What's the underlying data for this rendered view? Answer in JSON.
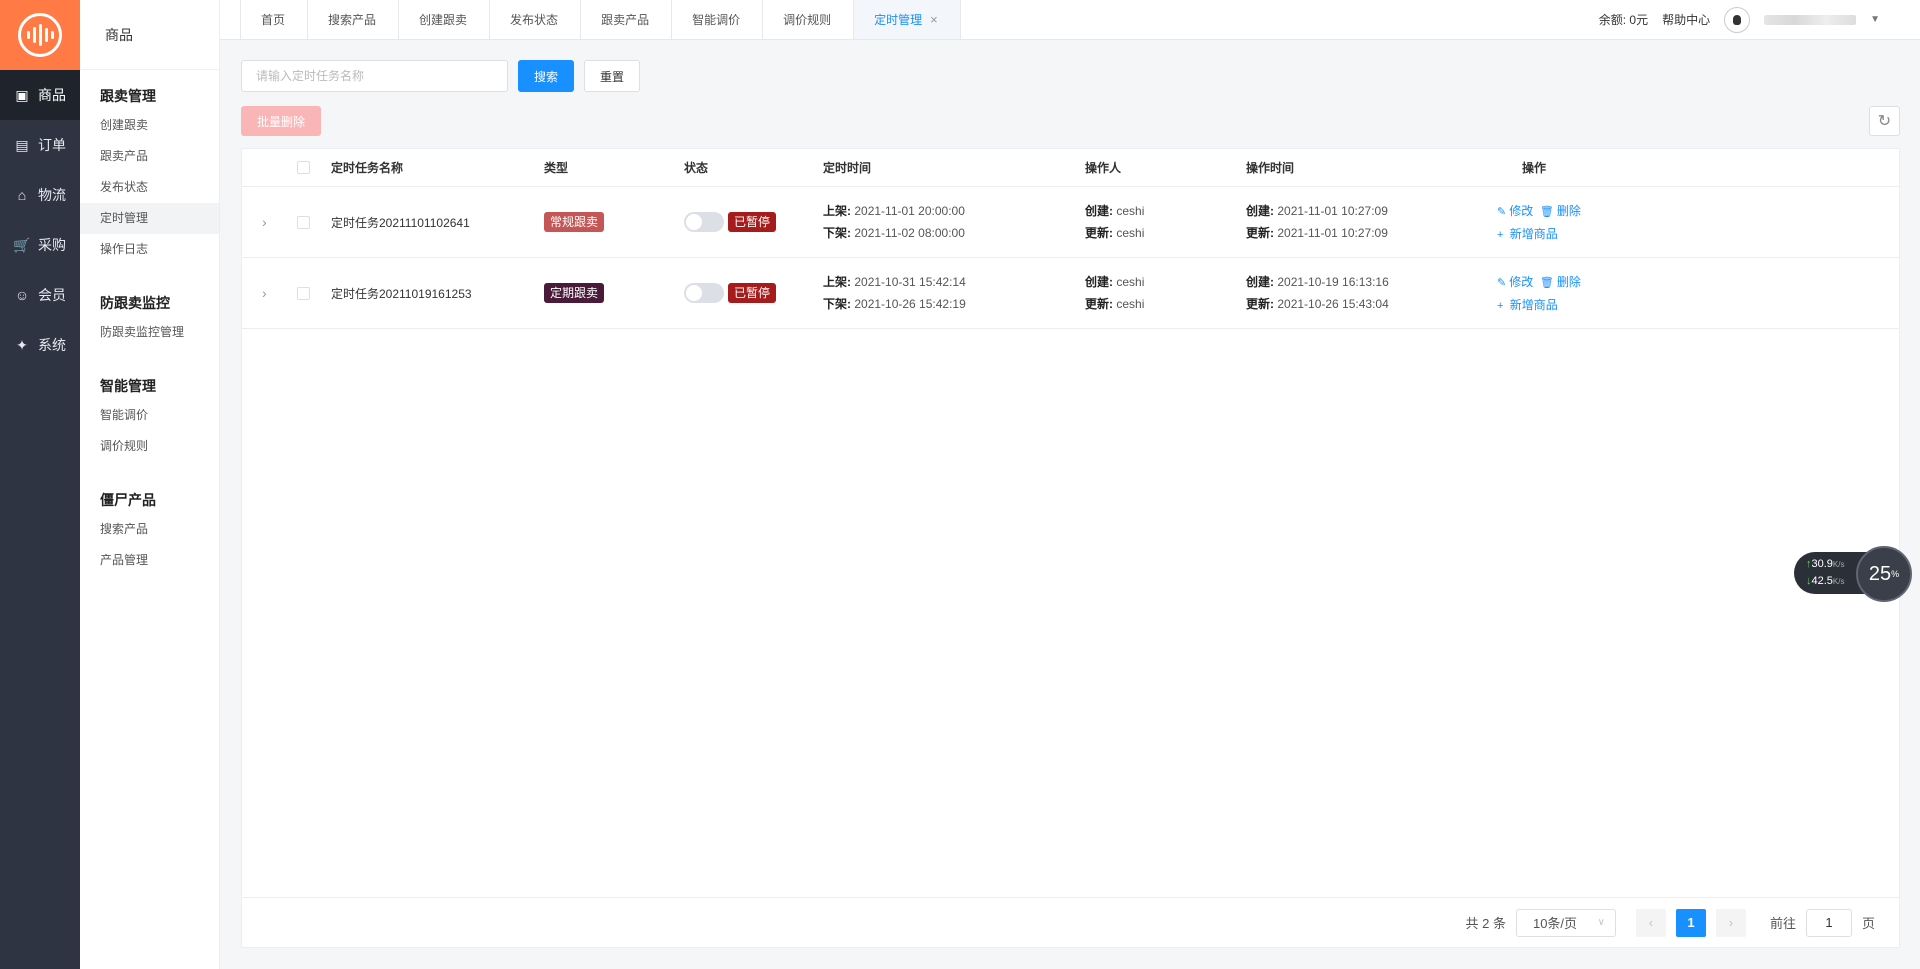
{
  "rail": {
    "items": [
      {
        "label": "商品",
        "icon": "goods-icon",
        "active": true
      },
      {
        "label": "订单",
        "icon": "order-icon",
        "active": false
      },
      {
        "label": "物流",
        "icon": "logistics-icon",
        "active": false
      },
      {
        "label": "采购",
        "icon": "cart-icon",
        "active": false
      },
      {
        "label": "会员",
        "icon": "user-icon",
        "active": false
      },
      {
        "label": "系统",
        "icon": "puzzle-icon",
        "active": false
      }
    ]
  },
  "sidebar": {
    "header": "商品",
    "groups": [
      {
        "title": "跟卖管理",
        "links": [
          "创建跟卖",
          "跟卖产品",
          "发布状态",
          "定时管理",
          "操作日志"
        ]
      },
      {
        "title": "防跟卖监控",
        "links": [
          "防跟卖监控管理"
        ]
      },
      {
        "title": "智能管理",
        "links": [
          "智能调价",
          "调价规则"
        ]
      },
      {
        "title": "僵尸产品",
        "links": [
          "搜索产品",
          "产品管理"
        ]
      }
    ],
    "active_link": "定时管理"
  },
  "tabs": [
    {
      "label": "首页"
    },
    {
      "label": "搜索产品"
    },
    {
      "label": "创建跟卖"
    },
    {
      "label": "发布状态"
    },
    {
      "label": "跟卖产品"
    },
    {
      "label": "智能调价"
    },
    {
      "label": "调价规则"
    },
    {
      "label": "定时管理",
      "active": true,
      "close": "×"
    }
  ],
  "header": {
    "balance": "余额: 0元",
    "help": "帮助中心"
  },
  "search": {
    "placeholder": "请输入定时任务名称",
    "search_label": "搜索",
    "reset_label": "重置",
    "batch_delete_label": "批量删除"
  },
  "table": {
    "columns": {
      "name": "定时任务名称",
      "type": "类型",
      "status": "状态",
      "time": "定时时间",
      "operator": "操作人",
      "op_time": "操作时间",
      "actions": "操作"
    },
    "rows": [
      {
        "name": "定时任务20211101102641",
        "type": "常规跟卖",
        "type_color": "#c45656",
        "status": "已暂停",
        "time_on_label": "上架:",
        "time_on": "2021-11-01 20:00:00",
        "time_off_label": "下架:",
        "time_off": "2021-11-02 08:00:00",
        "created_by_label": "创建:",
        "created_by": "ceshi",
        "updated_by_label": "更新:",
        "updated_by": "ceshi",
        "created_at_label": "创建:",
        "created_at": "2021-11-01 10:27:09",
        "updated_at_label": "更新:",
        "updated_at": "2021-11-01 10:27:09",
        "edit": "修改",
        "delete": "删除",
        "add": "新增商品"
      },
      {
        "name": "定时任务20211019161253",
        "type": "定期跟卖",
        "type_color": "#4a1a3a",
        "status": "已暂停",
        "time_on_label": "上架:",
        "time_on": "2021-10-31 15:42:14",
        "time_off_label": "下架:",
        "time_off": "2021-10-26 15:42:19",
        "created_by_label": "创建:",
        "created_by": "ceshi",
        "updated_by_label": "更新:",
        "updated_by": "ceshi",
        "created_at_label": "创建:",
        "created_at": "2021-10-19 16:13:16",
        "updated_at_label": "更新:",
        "updated_at": "2021-10-26 15:43:04",
        "edit": "修改",
        "delete": "删除",
        "add": "新增商品"
      }
    ]
  },
  "pagination": {
    "total": "共 2 条",
    "page_size": "10条/页",
    "current": "1",
    "goto_prefix": "前往",
    "goto_value": "1",
    "goto_suffix": "页"
  },
  "net_widget": {
    "up": "30.9",
    "up_unit": "K/s",
    "down": "42.5",
    "down_unit": "K/s",
    "percent": "25",
    "percent_unit": "%"
  },
  "colors": {
    "accent": "#1890ff",
    "brand": "#ff7a45",
    "rail_bg": "#2e3442",
    "status_paused": "#a61c1c"
  }
}
